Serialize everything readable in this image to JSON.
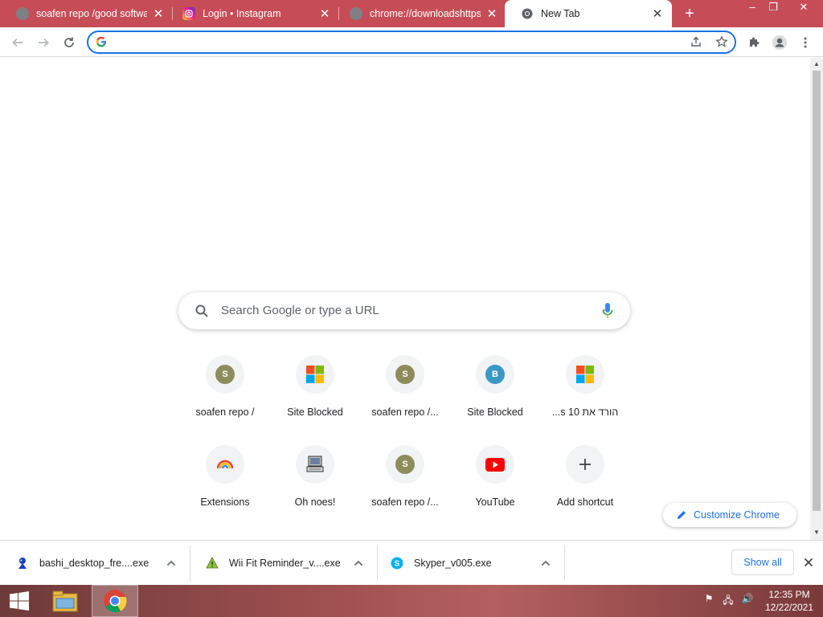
{
  "tabs": [
    {
      "title": "soafen repo /good softwar",
      "favicon": "globe-icon"
    },
    {
      "title": "Login • Instagram",
      "favicon": "instagram-icon"
    },
    {
      "title": "chrome://downloadshttps:/",
      "favicon": "globe-icon"
    },
    {
      "title": "New Tab",
      "favicon": "chrome-icon",
      "active": true
    }
  ],
  "window_controls": {
    "minimize": "–",
    "restore": "❐",
    "close": "✕"
  },
  "omnibox": {
    "value": "",
    "placeholder": ""
  },
  "search": {
    "placeholder": "Search Google or type a URL"
  },
  "shortcuts": [
    {
      "label": "soafen repo /",
      "icon": "letter-s-icon",
      "letter": "S",
      "color": "#8d8c5d"
    },
    {
      "label": "Site Blocked",
      "icon": "windows-logo-icon"
    },
    {
      "label": "soafen repo /...",
      "icon": "letter-s-icon",
      "letter": "S",
      "color": "#8d8c5d"
    },
    {
      "label": "Site Blocked",
      "icon": "letter-b-icon",
      "letter": "B",
      "color": "#3a98c4"
    },
    {
      "label": "...s 10 הורד את",
      "icon": "windows-logo-icon"
    },
    {
      "label": "Extensions",
      "icon": "rainbow-icon"
    },
    {
      "label": "Oh noes!",
      "icon": "computer-icon"
    },
    {
      "label": "soafen repo /...",
      "icon": "letter-s-icon",
      "letter": "S",
      "color": "#8d8c5d"
    },
    {
      "label": "YouTube",
      "icon": "youtube-icon"
    },
    {
      "label": "Add shortcut",
      "icon": "plus-icon"
    }
  ],
  "customize": {
    "label": "Customize Chrome"
  },
  "downloads": [
    {
      "name": "bashi_desktop_fre....exe",
      "icon": "bashi-icon"
    },
    {
      "name": "Wii Fit Reminder_v....exe",
      "icon": "warning-triangle-icon"
    },
    {
      "name": "Skyper_v005.exe",
      "icon": "skype-icon"
    }
  ],
  "shelf": {
    "show_all": "Show all"
  },
  "clock": {
    "time": "12:35 PM",
    "date": "12/22/2021"
  },
  "colors": {
    "tabstrip": "#c64d57",
    "accent": "#1a73e8"
  }
}
